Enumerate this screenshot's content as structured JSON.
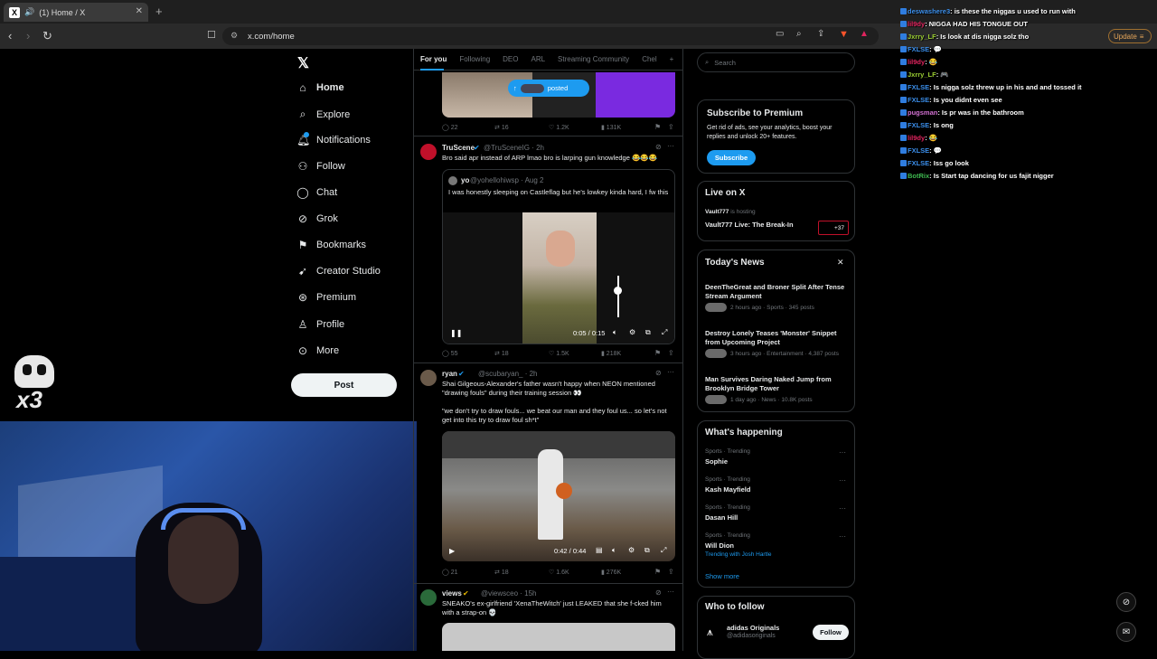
{
  "browser": {
    "tab_title": "(1) Home / X",
    "url": "x.com/home",
    "update_label": "Update"
  },
  "nav": {
    "items": [
      {
        "label": "Home",
        "icon": "home-icon"
      },
      {
        "label": "Explore",
        "icon": "search-icon"
      },
      {
        "label": "Notifications",
        "icon": "bell-icon"
      },
      {
        "label": "Follow",
        "icon": "person-add-icon"
      },
      {
        "label": "Chat",
        "icon": "chat-icon"
      },
      {
        "label": "Grok",
        "icon": "grok-icon"
      },
      {
        "label": "Bookmarks",
        "icon": "bookmark-icon"
      },
      {
        "label": "Creator Studio",
        "icon": "rocket-icon"
      },
      {
        "label": "Premium",
        "icon": "premium-icon"
      },
      {
        "label": "Profile",
        "icon": "person-icon"
      },
      {
        "label": "More",
        "icon": "more-icon"
      }
    ],
    "post_label": "Post"
  },
  "feed": {
    "tabs": [
      "For you",
      "Following",
      "DEO",
      "ARL",
      "Streaming Community",
      "Chel"
    ],
    "posted_pill": "posted",
    "tweet0": {
      "replies": "22",
      "reposts": "16",
      "likes": "1.2K",
      "views": "131K"
    },
    "tweet1": {
      "name": "TruScene",
      "handle": "@TruSceneIG · 2h",
      "text": "Bro said apr instead of ARP lmao bro is larping gun knowledge 😂😂😂",
      "quote_name": "yo",
      "quote_handle": "@yohellohiwsp · Aug 2",
      "quote_text": "I was honestly sleeping on Castleflag but he's lowkey kinda hard, I fw this",
      "video_time": "0:05 / 0:15",
      "replies": "55",
      "reposts": "18",
      "likes": "1.5K",
      "views": "218K"
    },
    "tweet2": {
      "name": "ryan",
      "handle": "@scubaryan_ · 2h",
      "text1": "Shai Gilgeous-Alexander's father wasn't happy when NEON mentioned \"drawing fouls\" during their training session 👀",
      "text2": "\"we don't try to draw fouls... we beat our man and they foul us... so let's not get into this try to draw foul sh*t\"",
      "video_time": "0:42 / 0:44",
      "replies": "21",
      "reposts": "18",
      "likes": "1.6K",
      "views": "276K"
    },
    "tweet3": {
      "name": "views",
      "handle": "@viewsceo · 15h",
      "text": "SNEAKO's ex-girlfriend 'XenaTheWitch' just LEAKED that she f-cked him with a strap-on 💀"
    }
  },
  "sidebar": {
    "search_placeholder": "Search",
    "premium": {
      "title": "Subscribe to Premium",
      "body": "Get rid of ads, see your analytics, boost your replies and unlock 20+ features.",
      "button": "Subscribe"
    },
    "live": {
      "title": "Live on X",
      "host": "Vault777",
      "hosting": "is hosting",
      "event": "Vault777 Live: The Break-In",
      "count": "+37"
    },
    "news": {
      "title": "Today's News",
      "items": [
        {
          "headline": "DeenTheGreat and Broner Split After Tense Stream Argument",
          "meta": "2 hours ago · Sports · 345 posts"
        },
        {
          "headline": "Destroy Lonely Teases 'Monster' Snippet from Upcoming Project",
          "meta": "3 hours ago · Entertainment · 4,387 posts"
        },
        {
          "headline": "Man Survives Daring Naked Jump from Brooklyn Bridge Tower",
          "meta": "1 day ago · News · 10.8K posts"
        }
      ]
    },
    "happening": {
      "title": "What's happening",
      "items": [
        {
          "category": "Sports · Trending",
          "name": "Sophie",
          "extra": ""
        },
        {
          "category": "Sports · Trending",
          "name": "Kash Mayfield",
          "extra": ""
        },
        {
          "category": "Sports · Trending",
          "name": "Dasan Hill",
          "extra": ""
        },
        {
          "category": "Sports · Trending",
          "name": "Will Dion",
          "extra": "Trending with Josh Hartle"
        }
      ],
      "show_more": "Show more"
    },
    "who_to_follow": {
      "title": "Who to follow",
      "name": "adidas Originals",
      "handle": "@adidasoriginals",
      "button": "Follow"
    }
  },
  "chat": {
    "lines": [
      {
        "user": "deswashere3",
        "color": "#3b8eea",
        "msg": ": is these the niggas u used to run with"
      },
      {
        "user": "lil9dy",
        "color": "#e0245e",
        "msg": ": NIGGA HAD HIS TONGUE OUT"
      },
      {
        "user": "Jxrry_LF",
        "color": "#9acd32",
        "msg": ": Is look at dis nigga solz tho"
      },
      {
        "user": "FXLSE",
        "color": "#3b8eea",
        "msg": ": 💬"
      },
      {
        "user": "lil9dy",
        "color": "#e0245e",
        "msg": ": 😂"
      },
      {
        "user": "Jxrry_LF",
        "color": "#9acd32",
        "msg": ": 🎮"
      },
      {
        "user": "FXLSE",
        "color": "#3b8eea",
        "msg": ": Is nigga solz threw up in his and and tossed it"
      },
      {
        "user": "FXLSE",
        "color": "#3b8eea",
        "msg": ": Is you didnt even see"
      },
      {
        "user": "pugsman",
        "color": "#d070d0",
        "msg": ": Is pr was in the bathroom"
      },
      {
        "user": "FXLSE",
        "color": "#3b8eea",
        "msg": ": Is ong"
      },
      {
        "user": "lil9dy",
        "color": "#e0245e",
        "msg": ": 😂"
      },
      {
        "user": "FXLSE",
        "color": "#3b8eea",
        "msg": ": 💬"
      },
      {
        "user": "FXLSE",
        "color": "#3b8eea",
        "msg": ": Iss go look"
      },
      {
        "user": "BotRix",
        "color": "#3fb950",
        "msg": ": Is Start tap dancing for us fajit nigger"
      }
    ]
  },
  "overlay": {
    "multiplier": "x3"
  }
}
